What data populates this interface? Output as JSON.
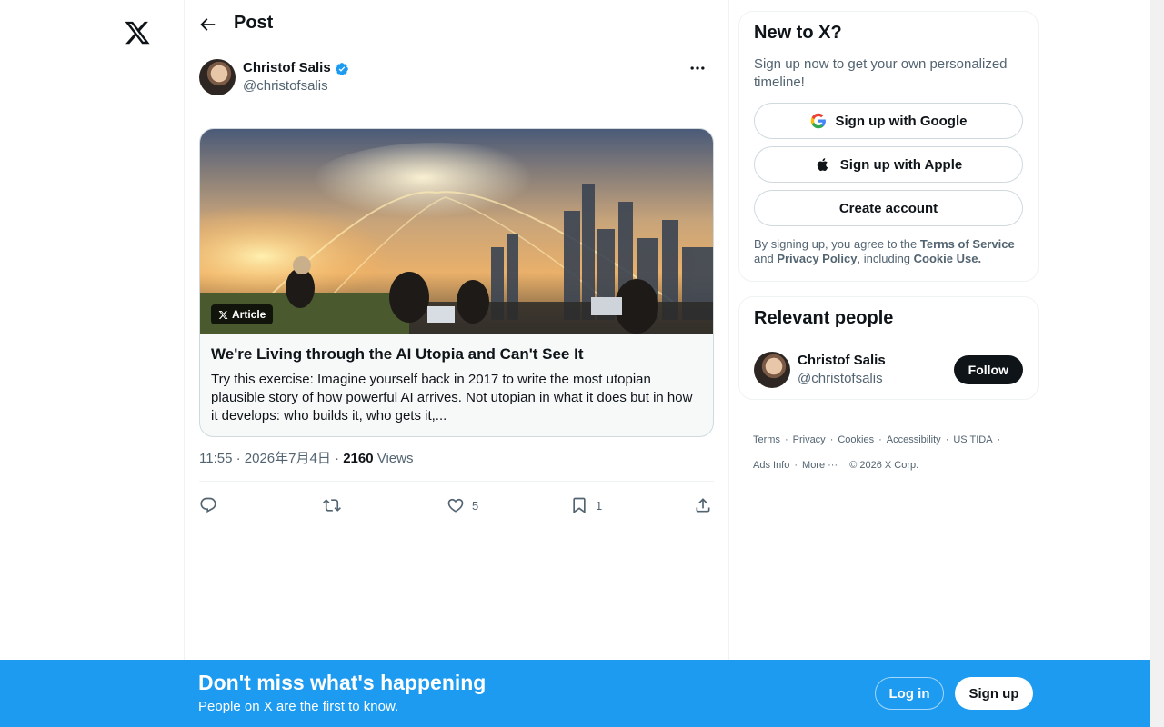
{
  "colors": {
    "accent": "#1d9bf0",
    "text": "#0f1419",
    "muted": "#536471",
    "border": "#cfd9de"
  },
  "nav": {
    "logo_icon": "x-logo-icon"
  },
  "header": {
    "title": "Post",
    "back_icon": "arrow-left-icon"
  },
  "post": {
    "author_name": "Christof Salis",
    "author_handle": "@christofsalis",
    "verified": true,
    "card": {
      "badge": "Article",
      "title": "We're Living through the AI Utopia and Can't See It",
      "description": "Try this exercise: Imagine yourself back in 2017 to write the most utopian plausible story of how powerful AI arrives. Not utopian in what it does but  in how it develops: who builds it, who gets it,..."
    },
    "time": "11:55",
    "date": "2026年7月4日",
    "views_count": "2160",
    "views_label": "Views",
    "actions": {
      "reply_count": "",
      "repost_count": "",
      "like_count": "5",
      "bookmark_count": "1"
    }
  },
  "signup": {
    "title": "New to X?",
    "subtitle": "Sign up now to get your own personalized timeline!",
    "google_label": "Sign up with Google",
    "apple_label": "Sign up with Apple",
    "create_label": "Create account",
    "legal_prefix": "By signing up, you agree to the ",
    "terms": "Terms of Service",
    "legal_and": " and ",
    "privacy": "Privacy Policy",
    "legal_including": ", including ",
    "cookie": "Cookie Use."
  },
  "relevant": {
    "title": "Relevant people",
    "name": "Christof Salis",
    "handle": "@christofsalis",
    "follow_label": "Follow"
  },
  "footer": {
    "links": [
      "Terms",
      "Privacy",
      "Cookies",
      "Accessibility",
      "US TIDA",
      "Ads Info",
      "More ···"
    ],
    "copyright": "© 2026 X Corp."
  },
  "banner": {
    "title": "Don't miss what's happening",
    "subtitle": "People on X are the first to know.",
    "login_label": "Log in",
    "signup_label": "Sign up"
  }
}
